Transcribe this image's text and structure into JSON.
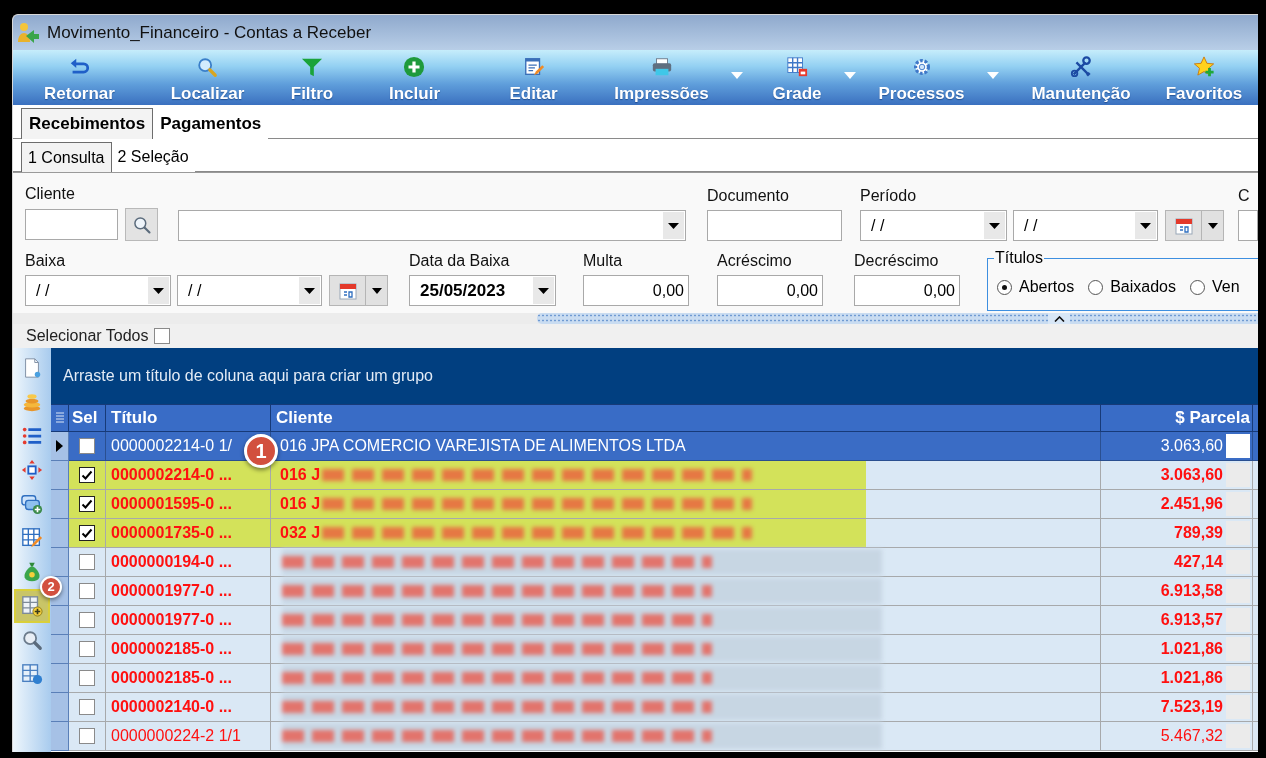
{
  "window": {
    "title": "Movimento_Financeiro - Contas a Receber"
  },
  "toolbar": [
    {
      "label": "Retornar",
      "dropdown": false
    },
    {
      "label": "Localizar",
      "dropdown": false
    },
    {
      "label": "Filtro",
      "dropdown": false
    },
    {
      "label": "Incluir",
      "dropdown": false
    },
    {
      "label": "Editar",
      "dropdown": false
    },
    {
      "label": "Impressões",
      "dropdown": true
    },
    {
      "label": "Grade",
      "dropdown": true
    },
    {
      "label": "Processos",
      "dropdown": true
    },
    {
      "label": "Manutenção",
      "dropdown": false
    },
    {
      "label": "Favoritos",
      "dropdown": false
    }
  ],
  "tabs": [
    {
      "label": "Recebimentos",
      "selected": true
    },
    {
      "label": "Pagamentos",
      "selected": false
    }
  ],
  "subtabs": [
    {
      "label": "1 Consulta",
      "selected": true
    },
    {
      "label": "2 Seleção",
      "selected": false
    }
  ],
  "filters": {
    "cliente": {
      "label": "Cliente"
    },
    "documento": {
      "label": "Documento"
    },
    "periodo": {
      "label": "Período",
      "from": "/ /",
      "to": "/ /"
    },
    "column_c": {
      "label": "C"
    },
    "baixa": {
      "label": "Baixa",
      "from": "/ /",
      "to": "/ /"
    },
    "data_da_baixa": {
      "label": "Data da Baixa",
      "value": "25/05/2023"
    },
    "multa": {
      "label": "Multa",
      "value": "0,00"
    },
    "acrescimo": {
      "label": "Acréscimo",
      "value": "0,00"
    },
    "decrescimo": {
      "label": "Decréscimo",
      "value": "0,00"
    },
    "titulos": {
      "label": "Títulos",
      "options": [
        {
          "label": "Abertos",
          "selected": true
        },
        {
          "label": "Baixados",
          "selected": false
        },
        {
          "label": "Ven",
          "selected": false
        }
      ]
    }
  },
  "select_all": {
    "label": "Selecionar Todos",
    "checked": false
  },
  "side_tools": [
    {
      "highlighted": false
    },
    {
      "highlighted": false
    },
    {
      "highlighted": false
    },
    {
      "highlighted": false
    },
    {
      "highlighted": false
    },
    {
      "highlighted": false
    },
    {
      "highlighted": false
    },
    {
      "highlighted": true,
      "callout": "2"
    },
    {
      "highlighted": false
    },
    {
      "highlighted": false
    }
  ],
  "grid": {
    "group_panel": "Arraste um título de coluna aqui para criar um grupo",
    "columns": [
      "Sel",
      "Título",
      "Cliente",
      "$ Parcela"
    ],
    "rows": [
      {
        "selected": true,
        "checked": false,
        "highlighted": false,
        "bold": false,
        "titulo": "0000002214-0 1/",
        "cliente": "016 JPA COMERCIO VAREJISTA DE ALIMENTOS LTDA",
        "cliente_blurred": false,
        "parcela": "3.063,60",
        "callout": "1"
      },
      {
        "selected": false,
        "checked": true,
        "highlighted": true,
        "bold": true,
        "titulo": "0000002214-0 ...",
        "cliente": "016 J",
        "cliente_blurred": true,
        "parcela": "3.063,60"
      },
      {
        "selected": false,
        "checked": true,
        "highlighted": true,
        "bold": true,
        "titulo": "0000001595-0 ...",
        "cliente": "016 J",
        "cliente_blurred": true,
        "parcela": "2.451,96"
      },
      {
        "selected": false,
        "checked": true,
        "highlighted": true,
        "bold": true,
        "titulo": "0000001735-0 ...",
        "cliente": "032 J",
        "cliente_blurred": true,
        "parcela": "789,39"
      },
      {
        "selected": false,
        "checked": false,
        "highlighted": false,
        "bold": true,
        "titulo": "0000000194-0 ...",
        "cliente_blurred": true,
        "parcela": "427,14"
      },
      {
        "selected": false,
        "checked": false,
        "highlighted": false,
        "bold": true,
        "titulo": "0000001977-0 ...",
        "cliente_blurred": true,
        "parcela": "6.913,58"
      },
      {
        "selected": false,
        "checked": false,
        "highlighted": false,
        "bold": true,
        "titulo": "0000001977-0 ...",
        "cliente_blurred": true,
        "parcela": "6.913,57"
      },
      {
        "selected": false,
        "checked": false,
        "highlighted": false,
        "bold": true,
        "titulo": "0000002185-0 ...",
        "cliente_blurred": true,
        "parcela": "1.021,86"
      },
      {
        "selected": false,
        "checked": false,
        "highlighted": false,
        "bold": true,
        "titulo": "0000002185-0 ...",
        "cliente_blurred": true,
        "parcela": "1.021,86"
      },
      {
        "selected": false,
        "checked": false,
        "highlighted": false,
        "bold": true,
        "titulo": "0000002140-0 ...",
        "cliente_blurred": true,
        "parcela": "7.523,19"
      },
      {
        "selected": false,
        "checked": false,
        "highlighted": false,
        "bold": false,
        "titulo": "0000000224-2 1/1",
        "cliente_blurred": true,
        "parcela": "5.467,32"
      }
    ]
  }
}
